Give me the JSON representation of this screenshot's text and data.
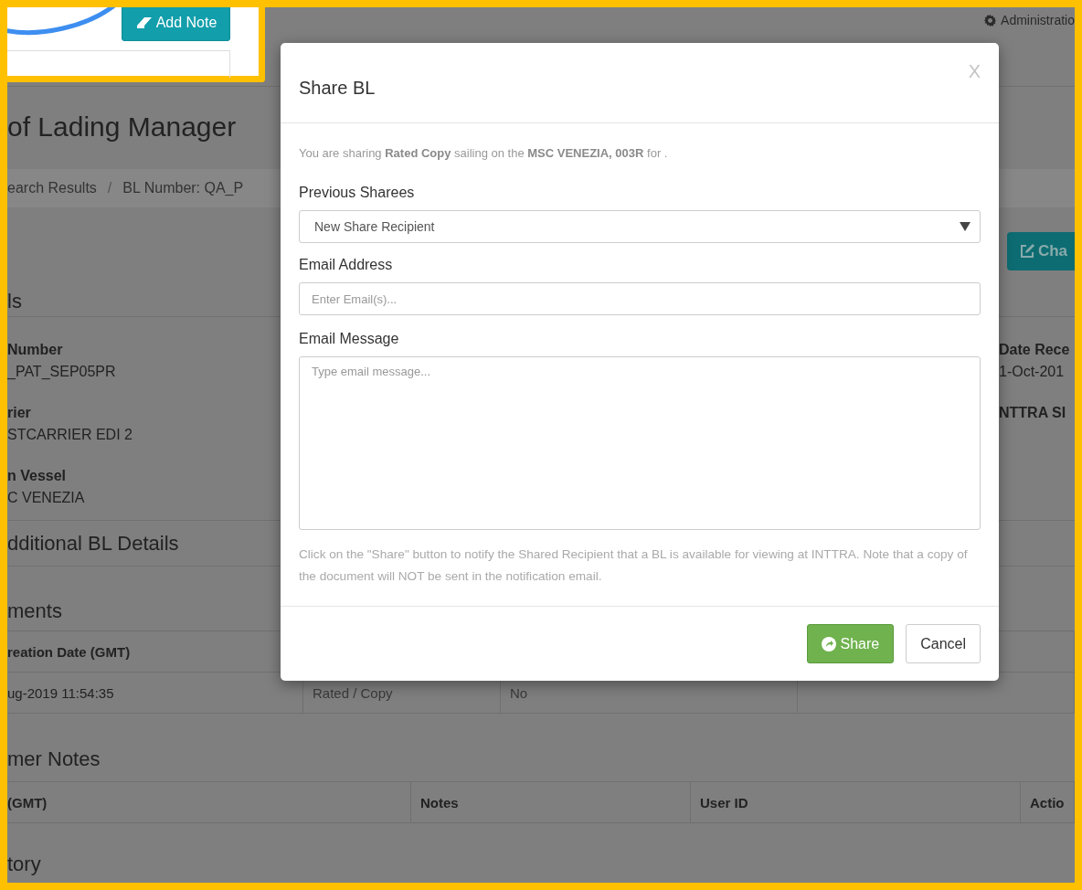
{
  "inset": {
    "add_note_button": "Add Note"
  },
  "page": {
    "admin_link": "Administratio",
    "title": "of Lading Manager",
    "breadcrumbs": [
      "earch Results",
      "BL Number: QA_P"
    ],
    "breadcrumb_separator": "/",
    "action_button": "Cha",
    "details": {
      "heading": "ls",
      "fields": [
        {
          "label": "Number",
          "value": "_PAT_SEP05PR"
        },
        {
          "label": "rier",
          "value": "STCARRIER EDI 2"
        },
        {
          "label": "n Vessel",
          "value": "C VENEZIA"
        }
      ],
      "side_fields": [
        {
          "label": "Date Rece",
          "value": "1-Oct-201"
        },
        {
          "label": "NTTRA SI"
        }
      ]
    },
    "additional_heading": "dditional BL Details",
    "documents": {
      "heading": "ments",
      "columns": [
        "reation Date (GMT)"
      ],
      "rows": [
        [
          "ug-2019 11:54:35",
          "Rated / Copy",
          "No"
        ]
      ]
    },
    "notes": {
      "heading": "mer Notes",
      "columns": [
        "(GMT)",
        "Notes",
        "User ID",
        "Actio"
      ]
    },
    "history_heading": "tory"
  },
  "modal": {
    "title": "Share BL",
    "close": "X",
    "info": "You are sharing **Rated Copy** sailing on the **MSC VENEZIA, 003R** for .",
    "previous_sharees": {
      "label": "Previous Sharees",
      "value": "New Share Recipient"
    },
    "email_address": {
      "label": "Email Address",
      "placeholder": "Enter Email(s)..."
    },
    "email_message": {
      "label": "Email Message",
      "placeholder": "Type email message..."
    },
    "help": "Click on the \"Share\" button to notify the Shared Recipient that a BL is available for viewing at INTTRA. Note that a copy of the document will NOT be sent in the notification email.",
    "buttons": [
      {
        "label": "Share",
        "kind": "primary"
      },
      {
        "label": "Cancel",
        "kind": "default"
      }
    ]
  }
}
